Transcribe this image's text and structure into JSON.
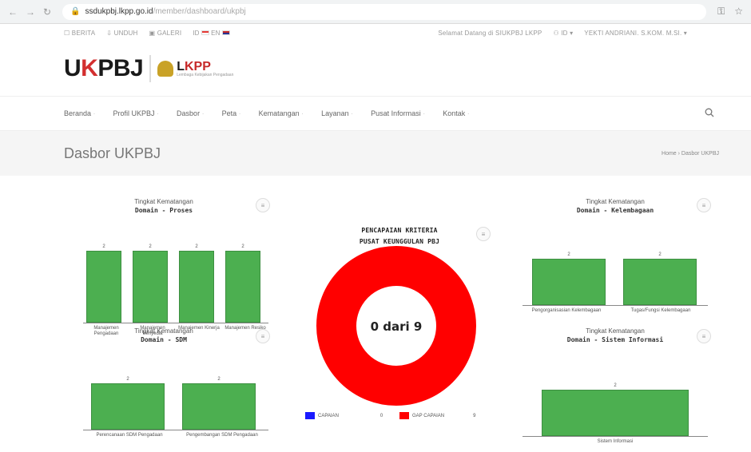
{
  "browser": {
    "url_host": "ssdukpbj.lkpp.go.id",
    "url_path": "/member/dashboard/ukpbj"
  },
  "topbar": {
    "berita": "☐ BERITA",
    "unduh": "⇩ UNDUH",
    "galeri": "▣ GALERI",
    "lang": "ID",
    "lang2": "EN",
    "welcome": "Selamat Datang di SIUKPBJ LKPP",
    "account_menu": "⚇ ID ▾",
    "user": "YEKTI ANDRIANI. S.KOM. M.SI. ▾"
  },
  "logo": {
    "ukpbj_u": "U",
    "ukpbj_k": "K",
    "ukpbj_rest": "PBJ",
    "lkpp_l": "L",
    "lkpp_kpp": "KPP",
    "lkpp_sub": "Lembaga Kebijakan Pengadaan"
  },
  "nav": {
    "items": [
      "Beranda",
      "Profil UKPBJ",
      "Dasbor",
      "Peta",
      "Kematangan",
      "Layanan",
      "Pusat Informasi",
      "Kontak"
    ],
    "search_icon": "search-icon"
  },
  "title": {
    "page_title": "Dasbor UKPBJ",
    "breadcrumb": "Home › Dasbor UKPBJ"
  },
  "menu_glyph": "≡",
  "panels": {
    "proses": {
      "title": "Tingkat Kematangan",
      "subtitle": "Domain - Proses",
      "chart": {
        "type": "bar",
        "categories": [
          "Manajemen Pengadaan",
          "Manajemen Penyedia",
          "Manajemen Kinerja",
          "Manajemen Resiko"
        ],
        "values": [
          2,
          2,
          2,
          2
        ],
        "value_labels": [
          "2",
          "2",
          "2",
          "2"
        ],
        "ylim": [
          0,
          2
        ]
      }
    },
    "sdm": {
      "title": "Tingkat Kematangan",
      "subtitle": "Domain - SDM",
      "chart": {
        "type": "bar",
        "categories": [
          "Perencanaan SDM Pengadaan",
          "Pengembangan SDM Pengadaan"
        ],
        "values": [
          2,
          2
        ],
        "value_labels": [
          "2",
          "2"
        ],
        "ylim": [
          0,
          2
        ]
      }
    },
    "kelembagaan": {
      "title": "Tingkat Kematangan",
      "subtitle": "Domain - Kelembagaan",
      "chart": {
        "type": "bar",
        "categories": [
          "Pengorganisasian Kelembagaan",
          "Tugas/Fungsi Kelembagaan"
        ],
        "values": [
          2,
          2
        ],
        "value_labels": [
          "2",
          "2"
        ],
        "ylim": [
          0,
          2
        ]
      }
    },
    "sistem": {
      "title": "Tingkat Kematangan",
      "subtitle": "Domain - Sistem Informasi",
      "chart": {
        "type": "bar",
        "categories": [
          "Sistem Informasi"
        ],
        "values": [
          2
        ],
        "value_labels": [
          "2"
        ],
        "ylim": [
          0,
          2
        ]
      }
    },
    "kriteria": {
      "title_line1": "PENCAPAIAN KRITERIA",
      "title_line2": "PUSAT KEUNGGULAN PBJ",
      "center": "0 dari 9",
      "chart": {
        "type": "pie",
        "categories": [
          "CAPAIAN",
          "GAP CAPAIAN"
        ],
        "values": [
          0,
          9
        ],
        "value_labels": [
          "0",
          "9"
        ],
        "colors": [
          "#1a1aff",
          "#ff0000"
        ]
      }
    }
  },
  "colors": {
    "bar": "#4caf50",
    "donut_gap": "#ff0000",
    "donut_capaian": "#1a1aff"
  }
}
